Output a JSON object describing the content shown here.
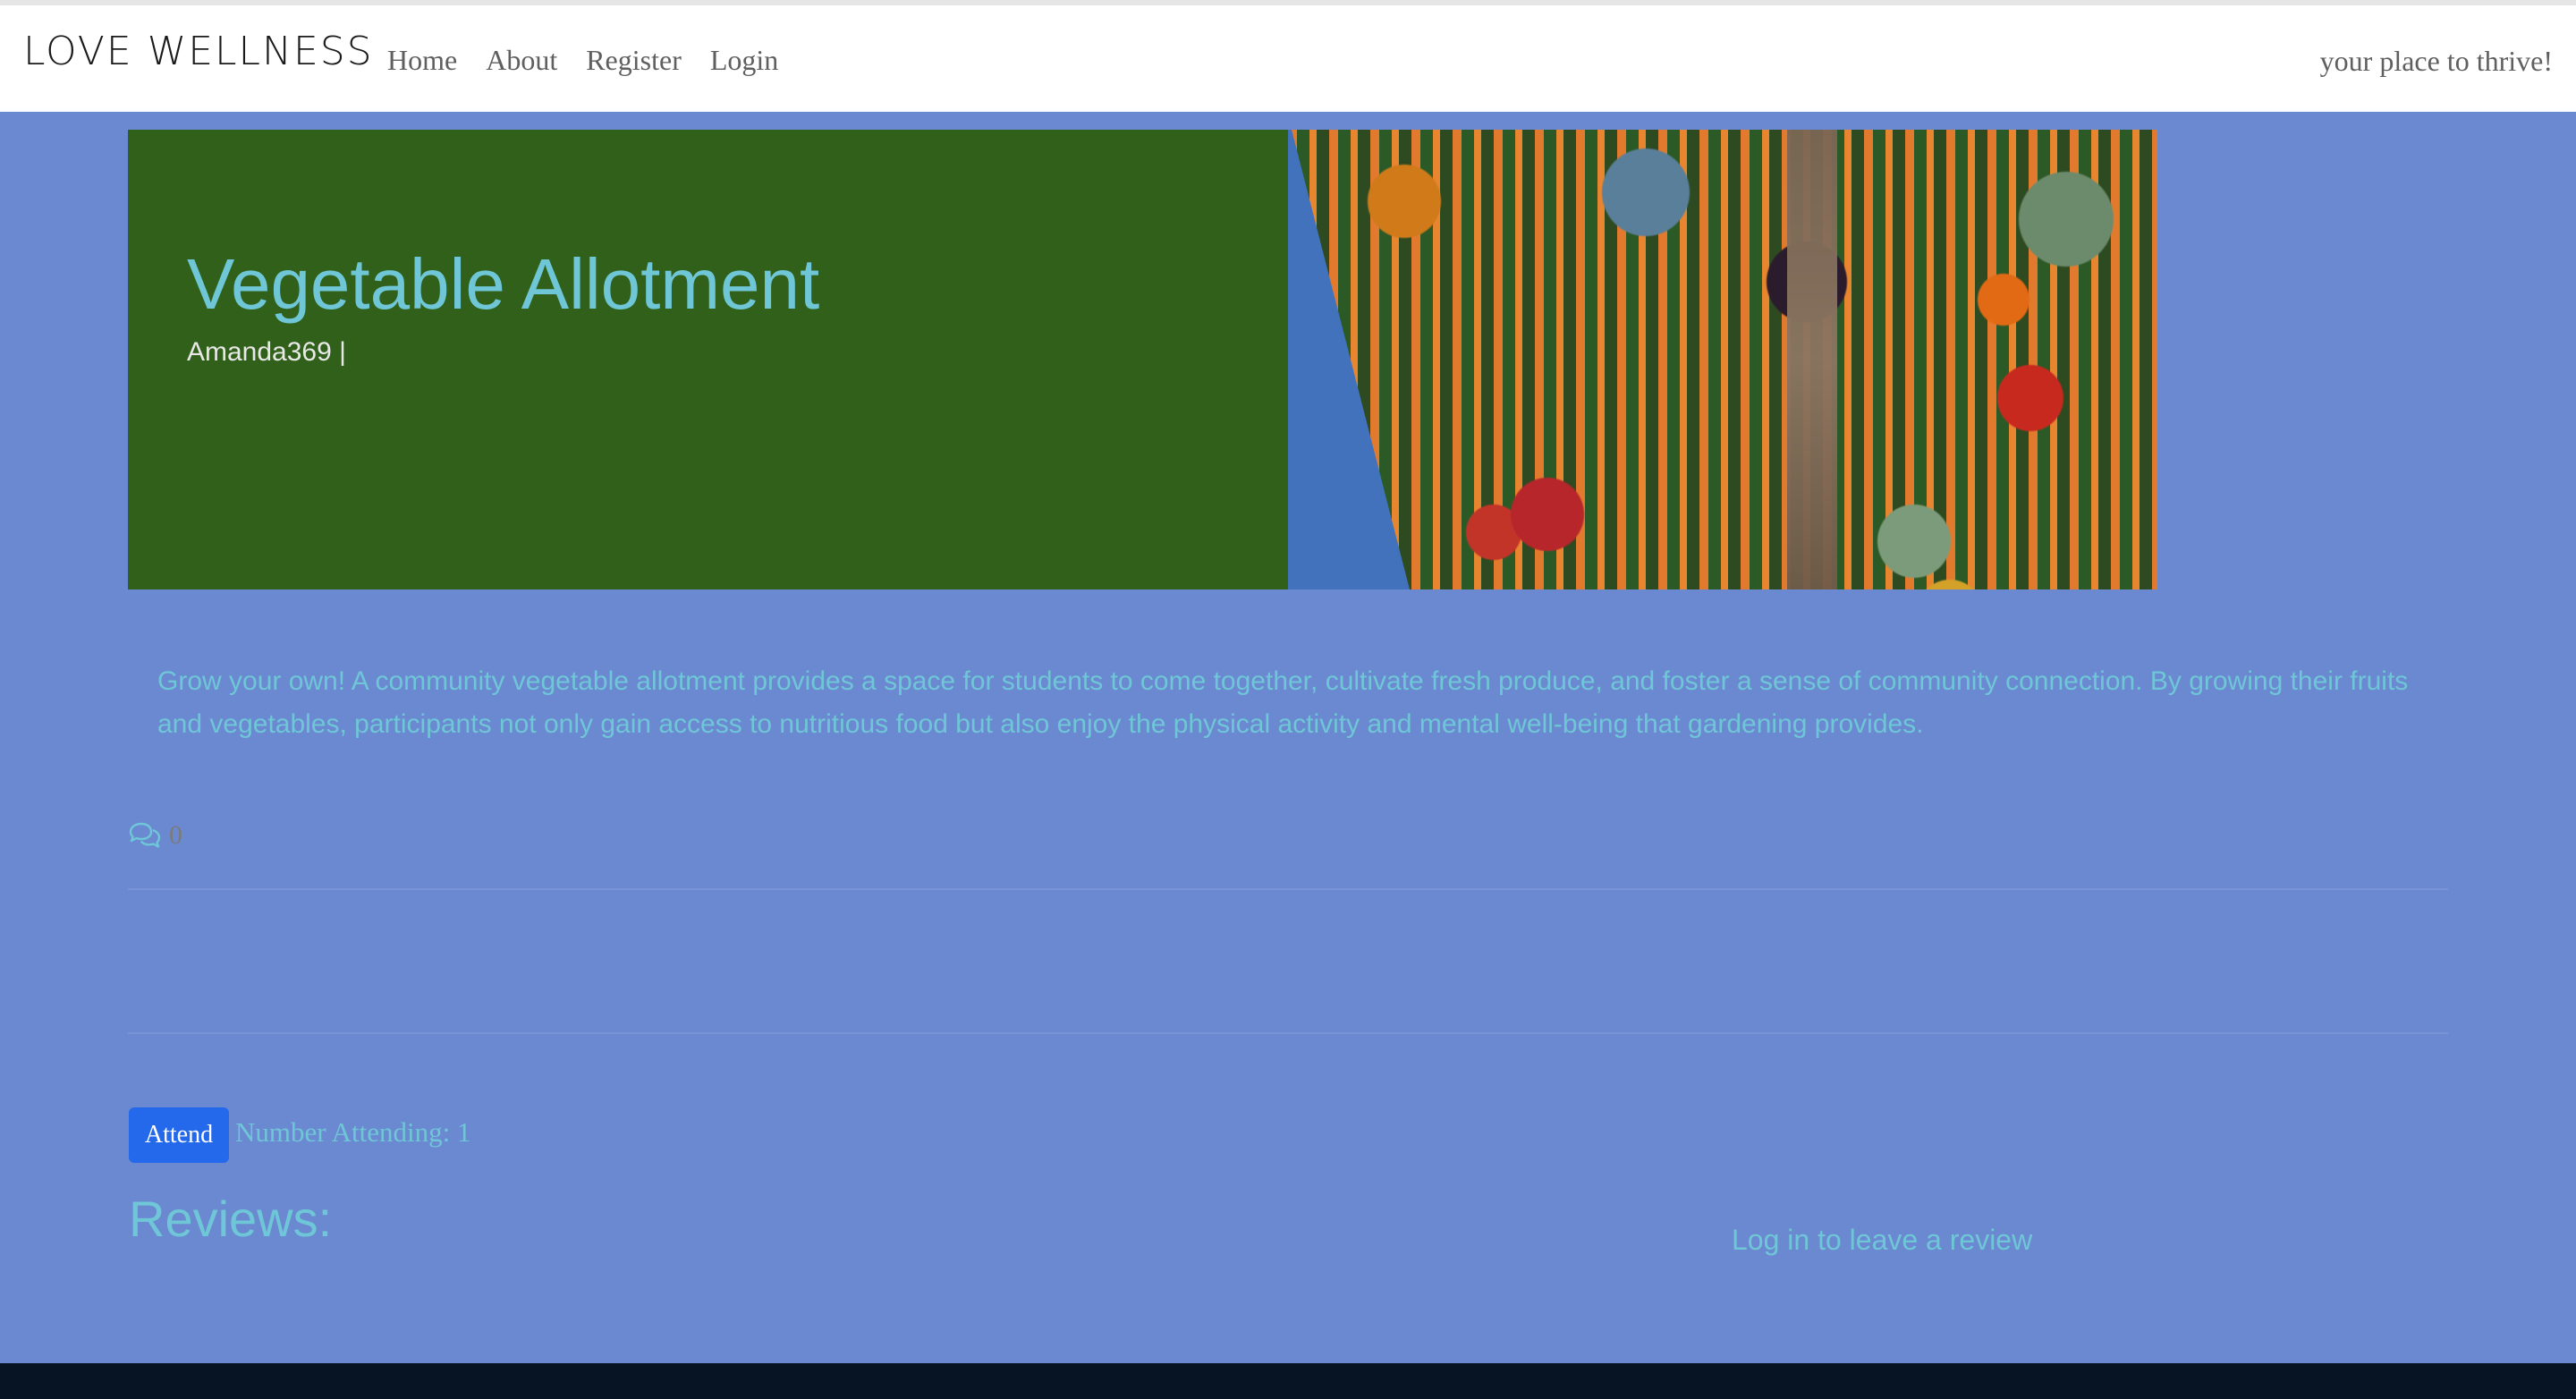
{
  "navbar": {
    "brand": "LOVE WELLNESS",
    "links": [
      "Home",
      "About",
      "Register",
      "Login"
    ],
    "tagline": "your place to thrive!"
  },
  "hero": {
    "title": "Vegetable Allotment",
    "author": "Amanda369 |",
    "image_description": "vegetable-garden-photo"
  },
  "post": {
    "description": "Grow your own! A community vegetable allotment provides a space for students to come together, cultivate fresh produce, and foster a sense of community connection. By growing their fruits and vegetables, participants not only gain access to nutritious food but also enjoy the physical activity and mental well-being that gardening provides.",
    "comment_icon": "comments-icon",
    "comment_count": "0"
  },
  "attendance": {
    "button_label": "Attend",
    "attending_text": "Number Attending: 1"
  },
  "reviews": {
    "heading": "Reviews:",
    "login_prompt": "Log in to leave a review"
  },
  "colors": {
    "page_background": "#6a89d1",
    "hero_green": "#306019",
    "accent_text": "#6fc6d6",
    "button_blue": "#2469ec",
    "footer": "#061424"
  }
}
